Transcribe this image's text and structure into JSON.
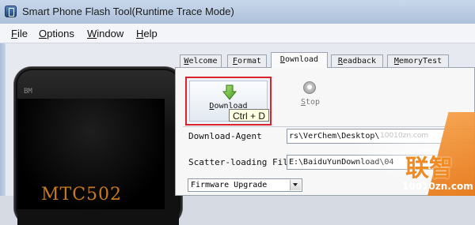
{
  "window": {
    "title": "Smart Phone Flash Tool(Runtime Trace Mode)"
  },
  "menu": [
    {
      "mnemonic": "F",
      "rest": "ile"
    },
    {
      "mnemonic": "O",
      "rest": "ptions"
    },
    {
      "mnemonic": "W",
      "rest": "indow"
    },
    {
      "mnemonic": "H",
      "rest": "elp"
    }
  ],
  "tabs": [
    {
      "mnemonic": "W",
      "rest": "elcome",
      "active": false
    },
    {
      "mnemonic": "F",
      "rest": "ormat",
      "active": false
    },
    {
      "mnemonic": "D",
      "rest": "ownload",
      "active": true
    },
    {
      "mnemonic": "R",
      "rest": "eadback",
      "active": false
    },
    {
      "mnemonic": "M",
      "rest": "emoryTest",
      "active": false
    }
  ],
  "toolbar": {
    "download": {
      "mnemonic": "D",
      "rest": "ownload",
      "icon": "green-down-arrow-icon",
      "highlight_color": "#d9232d"
    },
    "stop": {
      "mnemonic": "S",
      "rest": "top",
      "icon": "stop-icon"
    },
    "tooltip": "Ctrl + D"
  },
  "fields": {
    "download_agent": {
      "label": "Download-Agent",
      "value": "rs\\VerChem\\Desktop\\"
    },
    "scatter_file": {
      "label": "Scatter-loading File",
      "value": "E:\\BaiduYunDownload\\04"
    },
    "mode": {
      "selected": "Firmware Upgrade"
    }
  },
  "phone": {
    "badge": "BM",
    "brand_text": "MTC502"
  },
  "watermark": {
    "logo_text": "联智",
    "url": "10010zn.com",
    "faint": "10010zn.com"
  }
}
